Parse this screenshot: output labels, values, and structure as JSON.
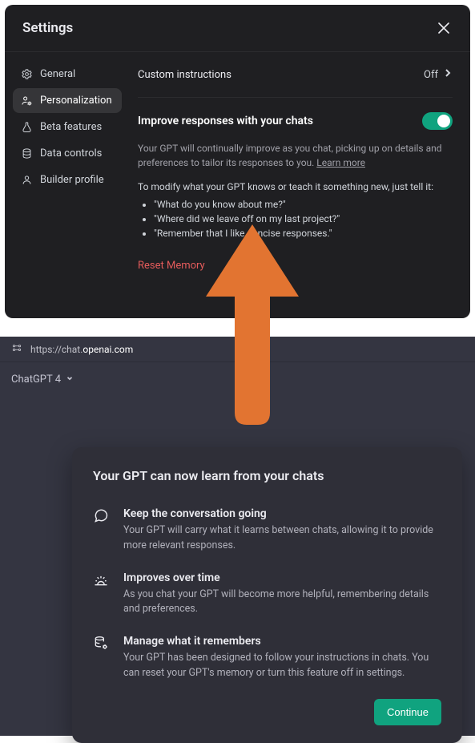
{
  "settings": {
    "title": "Settings",
    "sidebar": {
      "items": [
        {
          "key": "general",
          "label": "General"
        },
        {
          "key": "personalization",
          "label": "Personalization"
        },
        {
          "key": "beta",
          "label": "Beta features"
        },
        {
          "key": "data",
          "label": "Data controls"
        },
        {
          "key": "builder",
          "label": "Builder profile"
        }
      ],
      "active_key": "personalization"
    },
    "content": {
      "custom_instructions": {
        "label": "Custom instructions",
        "status": "Off"
      },
      "improve": {
        "title": "Improve responses with your chats",
        "enabled": true,
        "description_pre": "Your GPT will continually improve as you chat, picking up on details and preferences to tailor its responses to you. ",
        "learn_more": "Learn more",
        "modify_text": "To modify what your GPT knows or teach it something new, just tell it:",
        "examples": [
          "\"What do you know about me?\"",
          "\"Where did we leave off on my last project?\"",
          "\"Remember that I like concise responses.\""
        ],
        "reset_label": "Reset Memory"
      }
    }
  },
  "onboarding": {
    "url_prefix": "https://chat.",
    "url_domain": "openai.com",
    "model_label": "ChatGPT 4",
    "card": {
      "title": "Your GPT can now learn from your chats",
      "features": [
        {
          "title": "Keep the conversation going",
          "body": "Your GPT will carry what it learns between chats, allowing it to provide more relevant responses."
        },
        {
          "title": "Improves over time",
          "body": "As you chat your GPT will become more helpful, remembering details and preferences."
        },
        {
          "title": "Manage what it remembers",
          "body": "Your GPT has been designed to follow your instructions in chats. You can reset your GPT's memory or turn this feature off in settings."
        }
      ],
      "continue_label": "Continue"
    }
  },
  "arrow_color": "#e27431"
}
